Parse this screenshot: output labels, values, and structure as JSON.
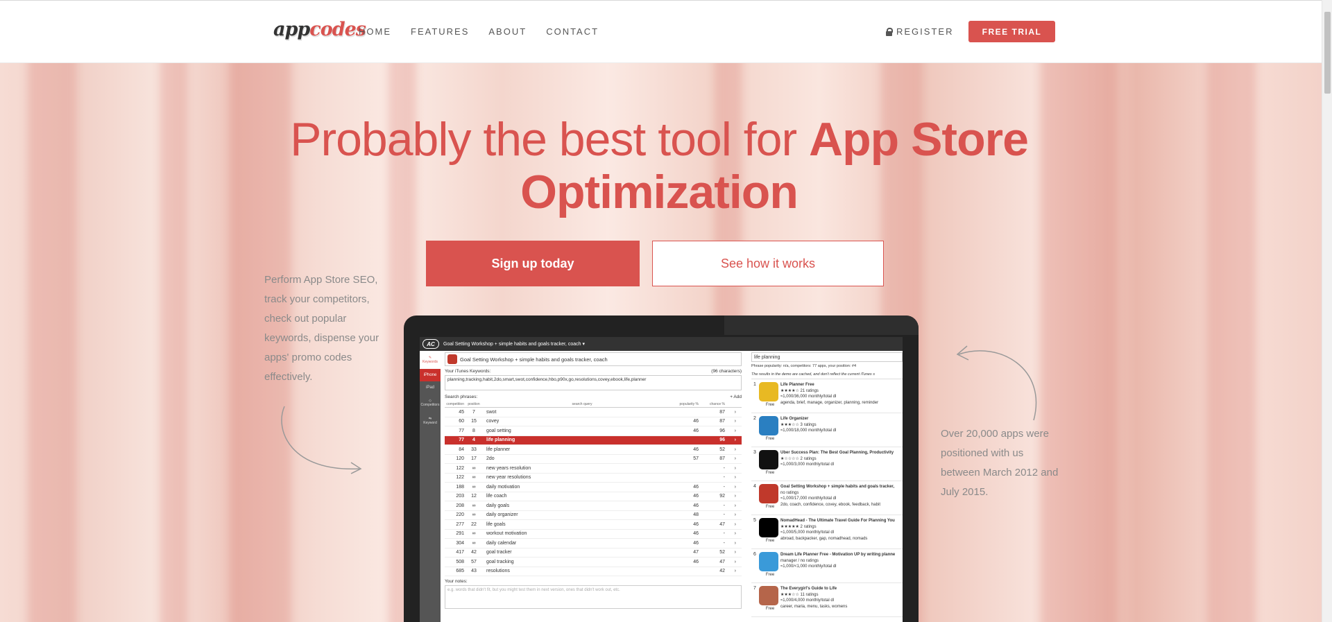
{
  "header": {
    "logo_a": "app",
    "logo_b": "codes",
    "nav": [
      "HOME",
      "FEATURES",
      "ABOUT",
      "CONTACT"
    ],
    "register": "REGISTER",
    "free_trial": "FREE TRIAL"
  },
  "hero": {
    "title_light": "Probably the best tool for ",
    "title_bold_1": "App Store",
    "title_bold_2": "Optimization",
    "signup": "Sign up today",
    "how": "See how it works",
    "side_left": "Perform App Store SEO, track your competitors, check out popular keywords, dispense your apps' promo codes effectively.",
    "side_right": "Over 20,000 apps were positioned with us between March 2012 and July 2015."
  },
  "app": {
    "top_title": "Goal Setting Workshop + simple habits and goals tracker, coach ▾",
    "ac_logo": "AC",
    "sidebar": [
      "Keywords",
      "iPhone",
      "iPad",
      "Competitors",
      "Keyword"
    ],
    "app_name": "Goal Setting Workshop + simple habits and goals tracker, coach",
    "kw_label": "Your iTunes Keywords:",
    "kw_chars": "(96 characters)",
    "keywords": "planning,tracking,habit,2do,smart,swot,confidence,hbo,p90x,go,resolutions,covey,ebook,life,planner",
    "phrases_label": "Search phrases:",
    "add": "+ Add",
    "headers": {
      "comp": "competition",
      "pos": "position",
      "q": "search query",
      "pop": "popularity %",
      "ch": "chance %"
    },
    "rows": [
      {
        "comp": "45",
        "pos": "7",
        "q": "swot",
        "pop": "",
        "ch": "87"
      },
      {
        "comp": "60",
        "pos": "15",
        "q": "covey",
        "pop": "46",
        "ch": "87"
      },
      {
        "comp": "77",
        "pos": "8",
        "q": "goal setting",
        "pop": "46",
        "ch": "96"
      },
      {
        "comp": "77",
        "pos": "4",
        "q": "life planning",
        "pop": "",
        "ch": "96",
        "sel": true
      },
      {
        "comp": "84",
        "pos": "33",
        "q": "life planner",
        "pop": "46",
        "ch": "52"
      },
      {
        "comp": "120",
        "pos": "17",
        "q": "2do",
        "pop": "57",
        "ch": "87"
      },
      {
        "comp": "122",
        "pos": "∞",
        "q": "new years resolution",
        "pop": "",
        "ch": "-"
      },
      {
        "comp": "122",
        "pos": "∞",
        "q": "new year resolutions",
        "pop": "",
        "ch": "-"
      },
      {
        "comp": "188",
        "pos": "∞",
        "q": "daily motivation",
        "pop": "46",
        "ch": "-"
      },
      {
        "comp": "203",
        "pos": "12",
        "q": "life coach",
        "pop": "46",
        "ch": "92"
      },
      {
        "comp": "208",
        "pos": "∞",
        "q": "daily goals",
        "pop": "46",
        "ch": "-"
      },
      {
        "comp": "220",
        "pos": "∞",
        "q": "daily organizer",
        "pop": "48",
        "ch": "-"
      },
      {
        "comp": "277",
        "pos": "22",
        "q": "life goals",
        "pop": "46",
        "ch": "47"
      },
      {
        "comp": "291",
        "pos": "∞",
        "q": "workout motivation",
        "pop": "46",
        "ch": "-"
      },
      {
        "comp": "304",
        "pos": "∞",
        "q": "daily calendar",
        "pop": "46",
        "ch": "-"
      },
      {
        "comp": "417",
        "pos": "42",
        "q": "goal tracker",
        "pop": "47",
        "ch": "52"
      },
      {
        "comp": "508",
        "pos": "57",
        "q": "goal tracking",
        "pop": "46",
        "ch": "47"
      },
      {
        "comp": "685",
        "pos": "43",
        "q": "resolutions",
        "pop": "",
        "ch": "42"
      }
    ],
    "notes_label": "Your notes:",
    "notes_placeholder": "e.g. words that didn't fit, but you might test them in next version, ones that didn't work out, etc.",
    "search_value": "life planning",
    "pop_line": "Phrase popularity: n/a, competitors: 77 apps, your position: #4",
    "cache_line": "The results in the demo are cached, and don't reflect the current iTunes s",
    "results": [
      {
        "n": "1",
        "title": "Life Planner Free",
        "l2": "★★★★☆ 21 ratings",
        "l3": "≈1,000/36,000 monthly/total dl",
        "l4": "agenda, brief, manage, organizer, planning, reminder",
        "price": "Free",
        "color": "#e8b923"
      },
      {
        "n": "2",
        "title": "Life Organizer",
        "l2": "★★★☆☆ 3 ratings",
        "l3": "≈1,000/18,000 monthly/total dl",
        "l4": "",
        "price": "Free",
        "color": "#2a7fc1"
      },
      {
        "n": "3",
        "title": "Uber Success Plan: The Best Goal Planning, Productivity",
        "l2": "★☆☆☆☆ 2 ratings",
        "l3": "≈1,000/3,000 monthly/total dl",
        "l4": "",
        "price": "Free",
        "color": "#111"
      },
      {
        "n": "4",
        "title": "Goal Setting Workshop + simple habits and goals tracker,",
        "l2": "no ratings",
        "l3": "≈1,000/17,000 monthly/total dl",
        "l4": "2do, coach, confidence, covey, ebook, feedback, habit",
        "price": "Free",
        "color": "#c0392b"
      },
      {
        "n": "5",
        "title": "NomadHead - The Ultimate Travel Guide For Planning You",
        "l2": "★★★★★ 2 ratings",
        "l3": "≈1,000/5,000 monthly/total dl",
        "l4": "abroad, backpacker, gap, nomadhead, nomads",
        "price": "Free",
        "color": "#000"
      },
      {
        "n": "6",
        "title": "Dream Life Planner Free - Motivation UP by writing planne",
        "l2": "manager / no ratings",
        "l3": "≈1,000/<1,000 monthly/total dl",
        "l4": "",
        "price": "Free",
        "color": "#3a9ad9"
      },
      {
        "n": "7",
        "title": "The Everygirl's Guide to Life",
        "l2": "★★★☆☆ 11 ratings",
        "l3": "≈1,000/4,000 monthly/total dl",
        "l4": "career, maria, menu, tasks, womens",
        "price": "Free",
        "color": "#b5654a"
      }
    ]
  }
}
